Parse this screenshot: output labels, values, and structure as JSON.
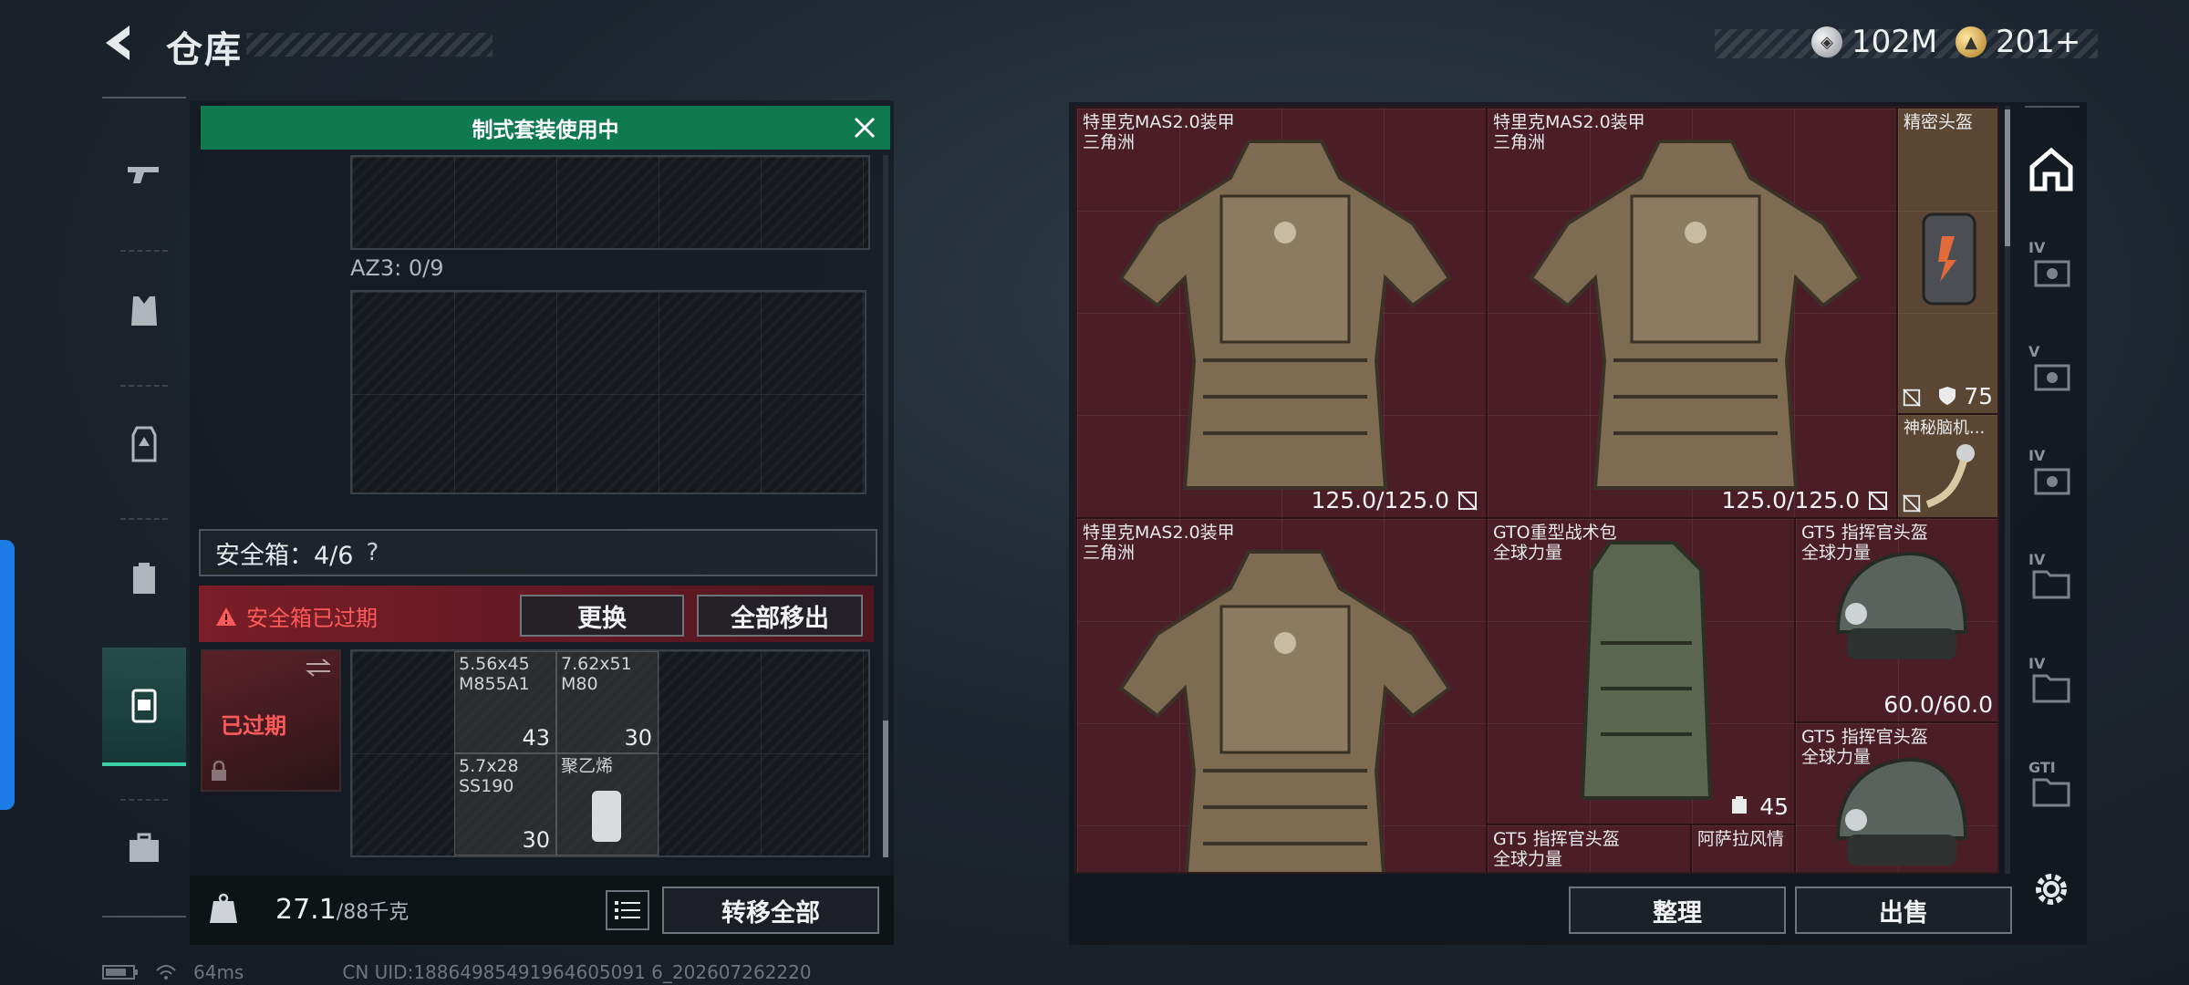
{
  "header": {
    "title": "仓库",
    "currency_1": "102M",
    "currency_2": "201+"
  },
  "banner": {
    "text": "制式套装使用中"
  },
  "container": {
    "az3_label": "AZ3: 0/9"
  },
  "safebox": {
    "label": "安全箱：4/6",
    "help": "?",
    "warning": "安全箱已过期",
    "replace_button": "更换",
    "remove_all_button": "全部移出",
    "expired_tag": "已过期",
    "items": [
      {
        "name": "5.56x45\nM855A1",
        "count": "43"
      },
      {
        "name": "7.62x51\nM80",
        "count": "30"
      },
      {
        "name": "5.7x28\nSS190",
        "count": "30"
      },
      {
        "name": "聚乙烯",
        "count": ""
      }
    ]
  },
  "footer_left": {
    "weight": "27.1",
    "weight_max": "/88千克",
    "transfer_all_button": "转移全部"
  },
  "stash": {
    "items": [
      {
        "name": "特里克MAS2.0装甲\n三角洲",
        "value": "125.0/125.0"
      },
      {
        "name": "特里克MAS2.0装甲\n三角洲",
        "value": "125.0/125.0"
      },
      {
        "name": "精密头盔",
        "value": "75"
      },
      {
        "name": "神秘脑机...",
        "value": ""
      },
      {
        "name": "特里克MAS2.0装甲\n三角洲",
        "value": ""
      },
      {
        "name": "GTO重型战术包\n全球力量",
        "value": "45"
      },
      {
        "name": "GT5 指挥官头盔\n全球力量",
        "value": "60.0/60.0"
      },
      {
        "name": "GT5 指挥官头盔\n全球力量",
        "value": ""
      },
      {
        "name": "GT5 指挥官头盔\n全球力量",
        "value": ""
      },
      {
        "name": "阿萨拉风情",
        "value": ""
      }
    ],
    "sort_button": "整理",
    "sell_button": "出售"
  },
  "right_rail": {
    "labels": [
      "IV",
      "V",
      "IV",
      "IV",
      "IV",
      "GTI"
    ]
  },
  "status": {
    "ping": "64ms",
    "uid": "CN UID:18864985491964605091 6_202607262220"
  },
  "colors": {
    "accent_green": "#0f7a50",
    "warning_red": "#ff5a5a",
    "rail_active": "#39d0a4",
    "edge_tab_blue": "#1e7ce8"
  }
}
